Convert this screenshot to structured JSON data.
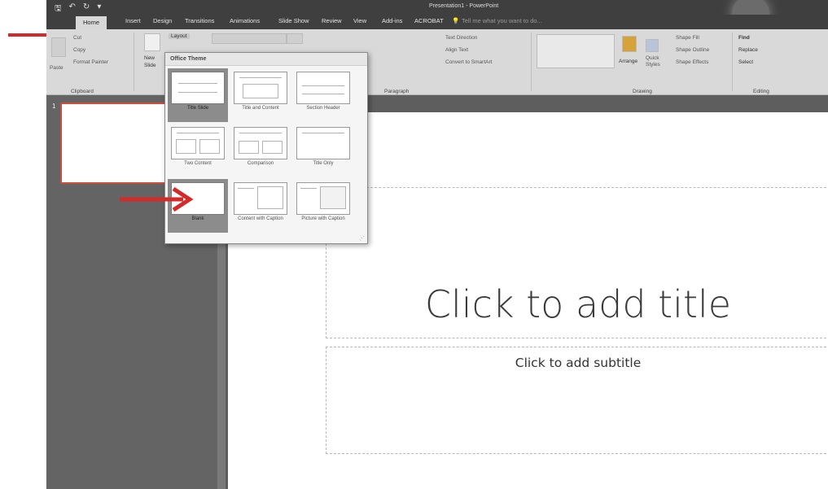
{
  "titlebar": {
    "title": "Presentation1 - PowerPoint",
    "qat": {
      "save": "🖫",
      "undo": "↶",
      "redo": "↻",
      "customize": "▾"
    }
  },
  "tabs": [
    "Home",
    "Insert",
    "Design",
    "Transitions",
    "Animations",
    "Slide Show",
    "Review",
    "View",
    "Add-ins",
    "ACROBAT"
  ],
  "active_tab": "Home",
  "tell_me": "Tell me what you want to do...",
  "ribbon": {
    "clipboard": {
      "paste": "Paste",
      "cut": "Cut",
      "copy": "Copy",
      "format_painter": "Format Painter",
      "label": "Clipboard"
    },
    "slides": {
      "new_slide": "New",
      "new_slide_2": "Slide",
      "layout": "Layout"
    },
    "paragraph": {
      "text_direction": "Text Direction",
      "align_text": "Align Text",
      "smartart": "Convert to SmartArt",
      "label": "Paragraph"
    },
    "drawing": {
      "arrange": "Arrange",
      "quick_styles": "Quick",
      "quick_styles_2": "Styles",
      "shape_fill": "Shape Fill",
      "shape_outline": "Shape Outline",
      "shape_effects": "Shape Effects",
      "label": "Drawing"
    },
    "editing": {
      "find": "Find",
      "replace": "Replace",
      "select": "Select",
      "label": "Editing"
    }
  },
  "gallery": {
    "header": "Office Theme",
    "selected": "Blank",
    "items": [
      "Title Slide",
      "Title and Content",
      "Section Header",
      "Two Content",
      "Comparison",
      "Title Only",
      "Blank",
      "Content with Caption",
      "Picture with Caption"
    ]
  },
  "thumbnails": {
    "slide_number": "1"
  },
  "slide": {
    "title_placeholder": "Click to add title",
    "subtitle_placeholder": "Click to add subtitle"
  },
  "colors": {
    "arrow": "#d42a2a",
    "thumb_border": "#d14b3a",
    "selected_layout": "#8c8c8c"
  }
}
